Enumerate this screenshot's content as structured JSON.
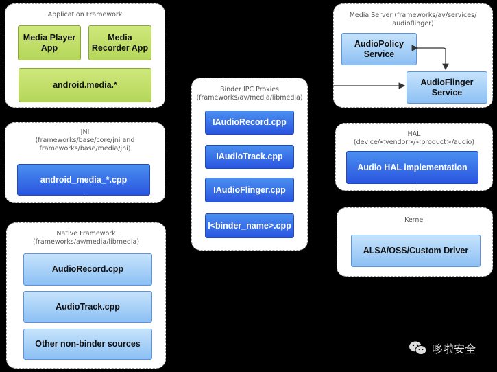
{
  "panels": {
    "app_framework": {
      "title": "Application Framework",
      "boxes": [
        "Media Player\nApp",
        "Media\nRecorder App",
        "android.media.*"
      ]
    },
    "jni": {
      "title": "JNI\n(frameworks/base/core/jni and\nframeworks/base/media/jni)",
      "boxes": [
        "android_media_*.cpp"
      ]
    },
    "native_framework": {
      "title": "Native Framework\n(frameworks/av/media/libmedia)",
      "boxes": [
        "AudioRecord.cpp",
        "AudioTrack.cpp",
        "Other non-binder sources"
      ]
    },
    "binder_ipc": {
      "title": "Binder IPC Proxies\n(frameworks/av/media/libmedia)",
      "boxes": [
        "IAudioRecord.cpp",
        "IAudioTrack.cpp",
        "IAudioFlinger.cpp",
        "I<binder_name>.cpp"
      ]
    },
    "media_server": {
      "title": "Media Server (frameworks/av/services/\naudioflinger)",
      "boxes": [
        "AudioPolicy\nService",
        "AudioFlinger\nService"
      ]
    },
    "hal": {
      "title": "HAL\n(device/<vendor>/<product>/audio)",
      "boxes": [
        "Audio HAL implementation"
      ]
    },
    "kernel": {
      "title": "Kernel",
      "boxes": [
        "ALSA/OSS/Custom Driver"
      ]
    }
  },
  "watermark": {
    "icon": "wechat-icon",
    "text": "哆啦安全"
  }
}
